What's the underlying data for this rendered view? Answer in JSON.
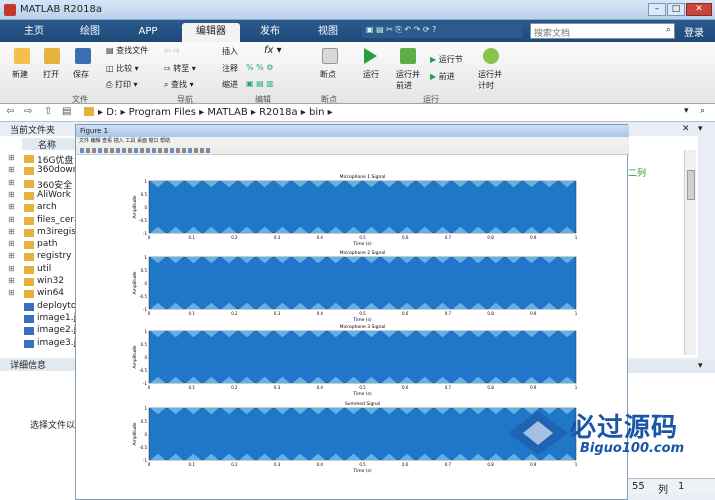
{
  "window": {
    "title": "MATLAB R2018a"
  },
  "tabs": [
    "主页",
    "绘图",
    "APP",
    "编辑器",
    "发布",
    "视图"
  ],
  "search": {
    "placeholder": "搜索文档"
  },
  "login": "登录",
  "ribbon": {
    "file": {
      "new": "新建",
      "open": "打开",
      "save": "保存",
      "find_files": "查找文件",
      "compare": "比较",
      "print": "打印",
      "section": "文件"
    },
    "nav": {
      "goto": "转至",
      "find": "查找",
      "section": "导航"
    },
    "edit": {
      "insert": "插入",
      "comment": "注释",
      "indent": "缩进",
      "section": "编辑"
    },
    "breakpoints": {
      "label": "断点",
      "section": "断点"
    },
    "run": {
      "run": "运行",
      "run_advance": "运行并前进",
      "run_section": "运行节",
      "advance": "前进",
      "run_time": "运行并计时",
      "section": "运行"
    }
  },
  "address": {
    "path": [
      "D:",
      "Program Files",
      "MATLAB",
      "R2018a",
      "bin"
    ]
  },
  "current_folder": {
    "title": "当前文件夹",
    "col_name": "名称",
    "items": [
      "16G优盘",
      "360down",
      "360安全",
      "AliWork",
      "arch",
      "files_cera",
      "m3iregis",
      "path",
      "registry",
      "util",
      "win32",
      "win64",
      "deployto",
      "image1.j",
      "image2.j",
      "image3.j"
    ]
  },
  "details": {
    "title": "详细信息",
    "hint": "选择文件以"
  },
  "right_panel": {
    "text": "二列"
  },
  "status": {
    "col_value": "55",
    "col_label": "列",
    "col_num": "1"
  },
  "figure": {
    "title": "Figure 1",
    "menu": "文件 编辑 查看 插入 工具 桌面 窗口 帮助",
    "titles": [
      "Microphone 1 Signal",
      "Microphone 2 Signal",
      "Microphone 3 Signal",
      "Summed Signal"
    ],
    "ylabel": "Amplitude",
    "xlabel": "Time (s)",
    "xticks": [
      "0",
      "0.1",
      "0.2",
      "0.3",
      "0.4",
      "0.5",
      "0.6",
      "0.7",
      "0.8",
      "0.9",
      "1"
    ],
    "yticks": [
      "1",
      "0.5",
      "0",
      "-0.5",
      "-1"
    ]
  },
  "watermark": {
    "main": "必过源码",
    "sub": "Biguo100.com"
  },
  "colors": {
    "signal": "#1f77c8",
    "signal_light": "#6aaee6",
    "tab_active": "#f3f3f3",
    "tabs_bg": "#1e4a7a"
  }
}
